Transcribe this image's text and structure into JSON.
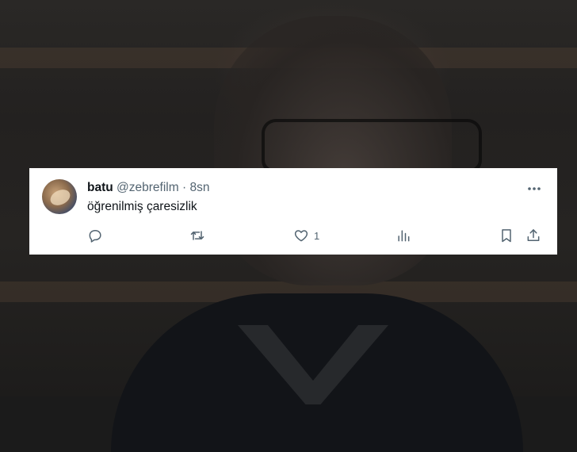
{
  "tweet": {
    "display_name": "batu",
    "handle": "@zebrefilm",
    "separator": "·",
    "time": "8sn",
    "text": "öğrenilmiş çaresizlik",
    "like_count": "1"
  },
  "icons": {
    "more": "more-horizontal-icon",
    "reply": "reply-icon",
    "retweet": "retweet-icon",
    "like": "heart-icon",
    "views": "analytics-icon",
    "bookmark": "bookmark-icon",
    "share": "share-icon"
  },
  "colors": {
    "text_primary": "#0f1419",
    "text_secondary": "#536471",
    "card_background": "#ffffff"
  }
}
